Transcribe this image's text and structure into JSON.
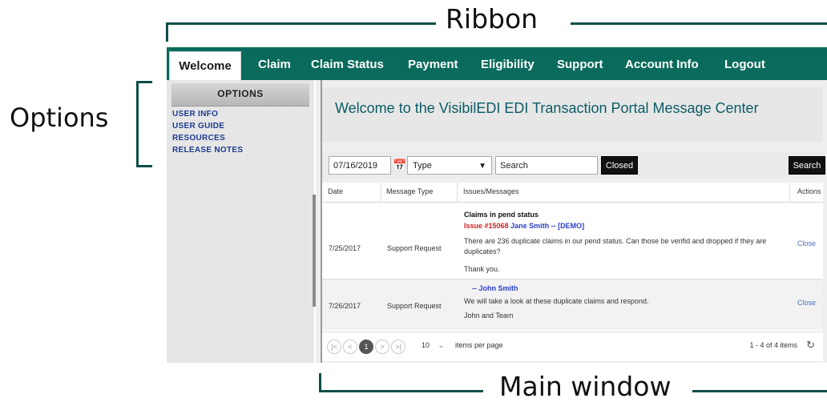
{
  "annotations": {
    "ribbon": "Ribbon",
    "options": "Options",
    "main_window": "Main window"
  },
  "ribbon": {
    "tabs": [
      "Welcome",
      "Claim",
      "Claim Status",
      "Payment",
      "Eligibility",
      "Support",
      "Account Info",
      "Logout"
    ],
    "active_tab": "Welcome",
    "color": "#0a6b5d"
  },
  "options": {
    "header": "OPTIONS",
    "links": [
      "USER INFO",
      "USER GUIDE",
      "RESOURCES",
      "RELEASE NOTES"
    ]
  },
  "main": {
    "welcome_title": "Welcome to the VisibilEDI EDI Transaction Portal Message Center",
    "filters": {
      "date": "07/16/2019",
      "type": "Type",
      "search_placeholder": "Search",
      "closed_label": "Closed",
      "search_button": "Search"
    },
    "table": {
      "headers": [
        "Date",
        "Message Type",
        "Issues/Messages",
        "Actions"
      ],
      "rows": [
        {
          "date": "7/25/2017",
          "type": "Support Request",
          "title": "Claims in pend status",
          "issue": "Issue #15068",
          "author": "Jane Smith -- [DEMO]",
          "body": "There are 236 duplicate claims in our pend status. Can those be verifid and dropped if they are duplicates?",
          "signoff": "Thank you.",
          "action": "Close"
        },
        {
          "date": "7/26/2017",
          "type": "Support Request",
          "author": "-- John Smith",
          "body": "We will take a look at these duplicate claims and respond.",
          "signoff": "John and Team",
          "action": "Close"
        }
      ]
    },
    "pager": {
      "first": "|<",
      "prev": "<",
      "current_page": "1",
      "next": ">",
      "last": ">|",
      "page_size": "10",
      "page_size_label": "items per page",
      "count": "1 - 4 of 4 items"
    }
  }
}
